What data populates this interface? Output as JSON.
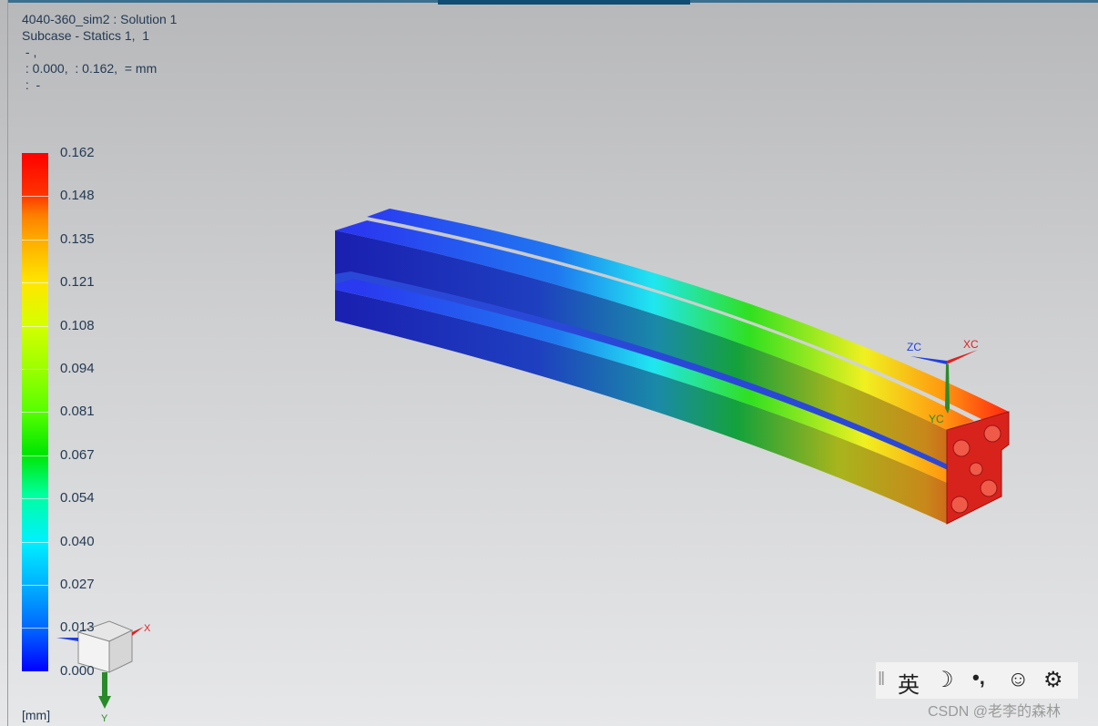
{
  "header": {
    "line1": "4040-360_sim2 : Solution 1",
    "line2": "Subcase - Statics 1,  1",
    "line3": " - ,",
    "line4": " : 0.000,  : 0.162,  = mm",
    "line5": " :  -"
  },
  "legend": {
    "values": [
      "0.162",
      "0.148",
      "0.135",
      "0.121",
      "0.108",
      "0.094",
      "0.081",
      "0.067",
      "0.054",
      "0.040",
      "0.027",
      "0.013",
      "0.000"
    ],
    "unit": "[mm]"
  },
  "model_axes": {
    "z": "ZC",
    "x": "XC",
    "y": "YC"
  },
  "view_axes": {
    "x": "X",
    "y": "Y"
  },
  "taskbar": {
    "separator": "‖",
    "lang": "英",
    "moon": "☽",
    "punct": "•,",
    "emoji": "☺",
    "gear": "⚙"
  },
  "watermark": "CSDN @老李的森林",
  "colors": {
    "accent": "#0f4d74",
    "text": "#243a53"
  }
}
